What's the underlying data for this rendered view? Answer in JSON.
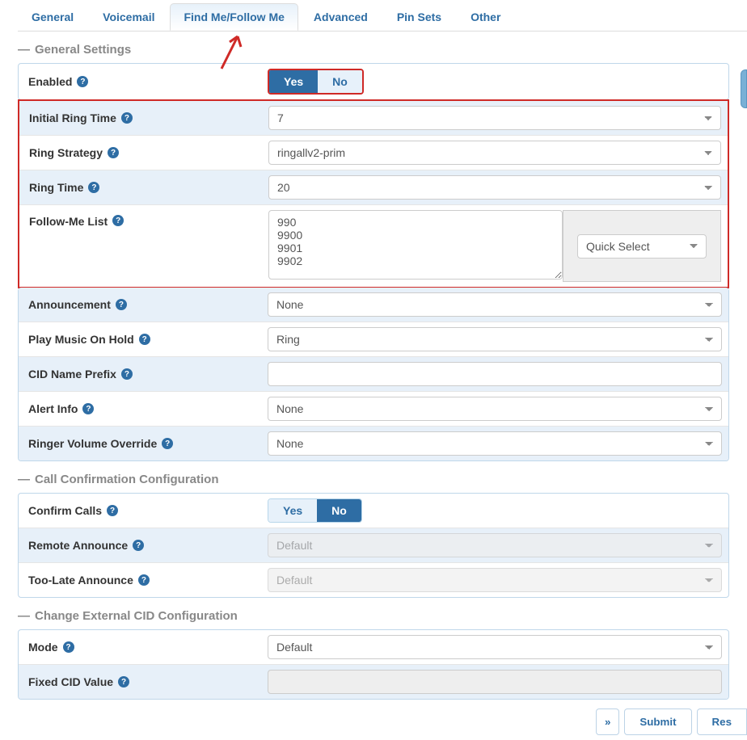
{
  "tabs": [
    "General",
    "Voicemail",
    "Find Me/Follow Me",
    "Advanced",
    "Pin Sets",
    "Other"
  ],
  "active_tab": 2,
  "sections": {
    "general": {
      "title": "General Settings",
      "enabled": {
        "label": "Enabled",
        "options": [
          "Yes",
          "No"
        ],
        "selected": 0
      },
      "initial_ring_time": {
        "label": "Initial Ring Time",
        "value": "7"
      },
      "ring_strategy": {
        "label": "Ring Strategy",
        "value": "ringallv2-prim"
      },
      "ring_time": {
        "label": "Ring Time",
        "value": "20"
      },
      "follow_me_list": {
        "label": "Follow-Me List",
        "value": "990\n9900\n9901\n9902",
        "quick_select": "Quick Select"
      },
      "announcement": {
        "label": "Announcement",
        "value": "None"
      },
      "play_music_on_hold": {
        "label": "Play Music On Hold",
        "value": "Ring"
      },
      "cid_name_prefix": {
        "label": "CID Name Prefix",
        "value": ""
      },
      "alert_info": {
        "label": "Alert Info",
        "value": "None"
      },
      "ringer_volume_override": {
        "label": "Ringer Volume Override",
        "value": "None"
      }
    },
    "call_confirm": {
      "title": "Call Confirmation Configuration",
      "confirm_calls": {
        "label": "Confirm Calls",
        "options": [
          "Yes",
          "No"
        ],
        "selected": 1
      },
      "remote_announce": {
        "label": "Remote Announce",
        "value": "Default"
      },
      "too_late_announce": {
        "label": "Too-Late Announce",
        "value": "Default"
      }
    },
    "external_cid": {
      "title": "Change External CID Configuration",
      "mode": {
        "label": "Mode",
        "value": "Default"
      },
      "fixed_cid_value": {
        "label": "Fixed CID Value",
        "value": ""
      }
    }
  },
  "actions": {
    "submit": "Submit",
    "reset": "Res",
    "chevron": "»"
  }
}
